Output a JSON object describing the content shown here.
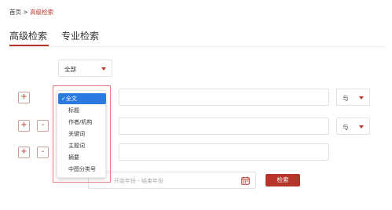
{
  "breadcrumb": {
    "home": "首页",
    "sep": ">",
    "current": "高级检索"
  },
  "tabs": [
    {
      "label": "高级检索"
    },
    {
      "label": "专业检索"
    }
  ],
  "scope_select": {
    "value": "全部"
  },
  "rows": [
    {
      "connector": "与"
    },
    {
      "connector": "与"
    }
  ],
  "field_dropdown": {
    "options": [
      "全文",
      "标题",
      "作者/机构",
      "关键词",
      "主题词",
      "摘要",
      "中图分类号"
    ],
    "selected": "✓全文"
  },
  "buttons": {
    "add": "+",
    "remove": "-",
    "search": "检索"
  },
  "year_range": {
    "placeholder": "开始年份 - 结束年份"
  },
  "colors": {
    "accent": "#b5352b",
    "selection": "#2a7ae2",
    "highlight_border": "#e07b86"
  }
}
